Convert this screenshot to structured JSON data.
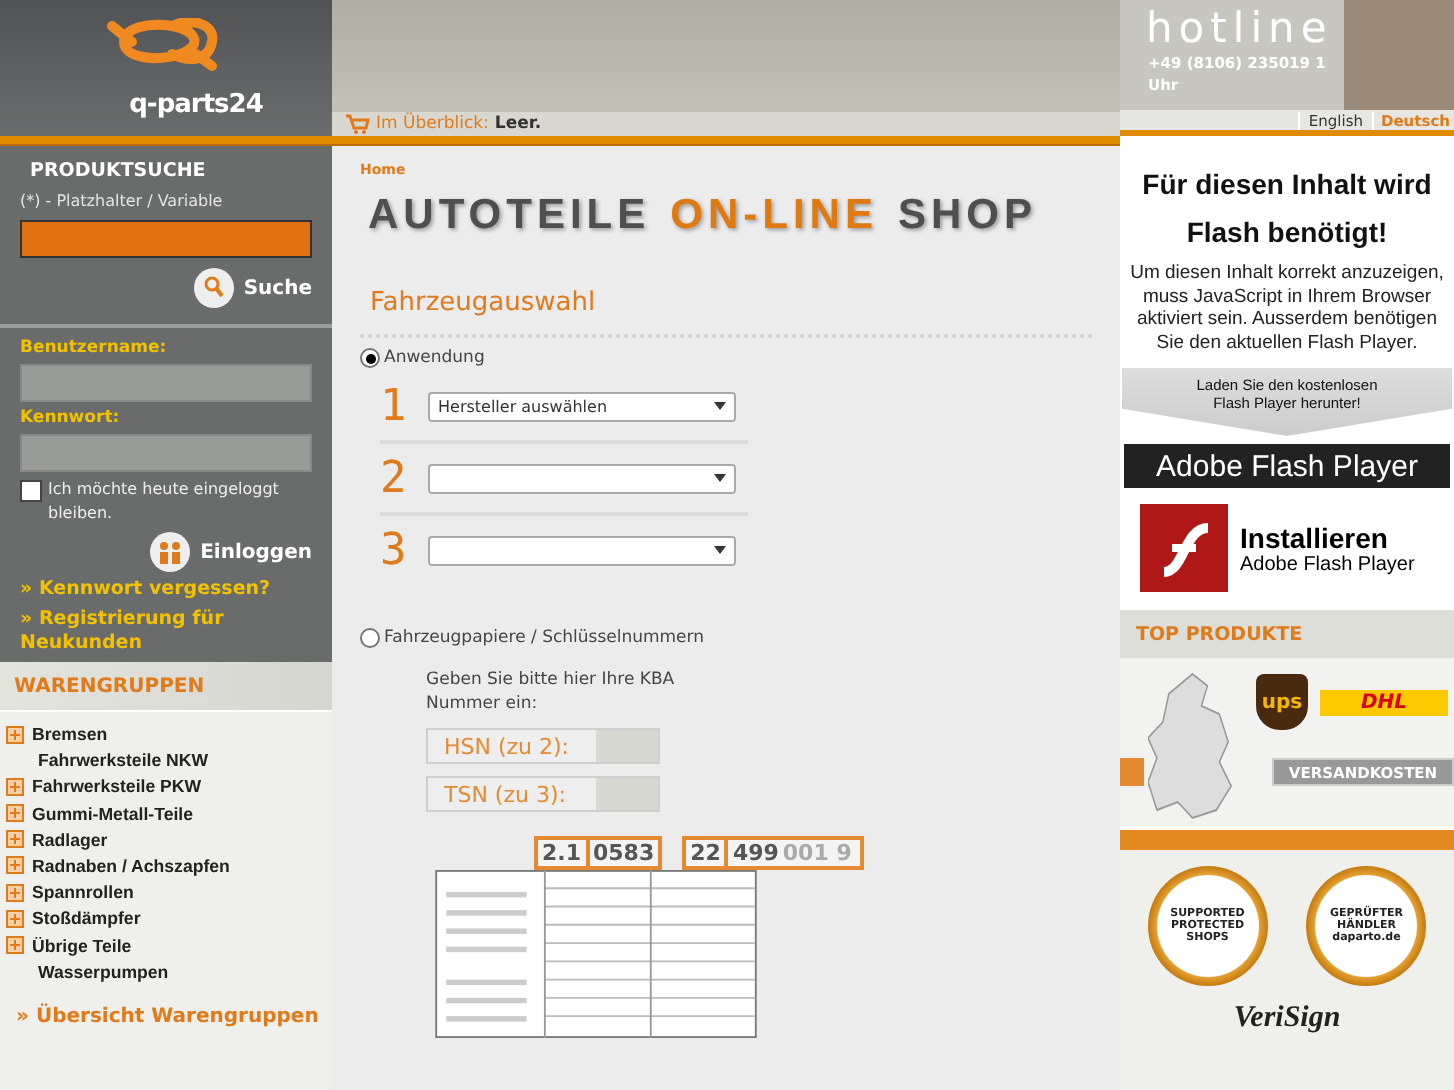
{
  "header": {
    "logo_text": "q-parts24",
    "cart_label": "Im Überblick:",
    "cart_value": "Leer.",
    "hotline": "hotline",
    "hotline_phone": "+49 (8106) 235019 1",
    "hotline_hours": "Uhr",
    "languages": [
      {
        "label": "English",
        "selected": false
      },
      {
        "label": "Deutsch",
        "selected": true
      }
    ]
  },
  "sidebar": {
    "search_title": "PRODUKTSUCHE",
    "search_hint": "(*) - Platzhalter / Variable",
    "search_button": "Suche",
    "username_label": "Benutzername:",
    "password_label": "Kennwort:",
    "remember": {
      "label": "Ich möchte heute eingeloggt bleiben.",
      "checked": false
    },
    "login_button": "Einloggen",
    "link_mark": "»",
    "links": [
      "Kennwort vergessen?",
      "Registrierung für Neukunden"
    ],
    "groups_title": "WARENGRUPPEN",
    "groups": [
      {
        "label": "Bremsen",
        "kind": "group"
      },
      {
        "label": "Fahrwerksteile NKW",
        "kind": "leaf"
      },
      {
        "label": "Fahrwerksteile PKW",
        "kind": "group"
      },
      {
        "label": "Gummi-Metall-Teile",
        "kind": "group"
      },
      {
        "label": "Radlager",
        "kind": "group"
      },
      {
        "label": "Radnaben / Achszapfen",
        "kind": "group"
      },
      {
        "label": "Spannrollen",
        "kind": "group"
      },
      {
        "label": "Stoßdämpfer",
        "kind": "group"
      },
      {
        "label": "Übrige Teile",
        "kind": "group"
      },
      {
        "label": "Wasserpumpen",
        "kind": "leaf"
      }
    ],
    "overview_mark": "»",
    "overview_link": "Übersicht Warengruppen"
  },
  "main": {
    "breadcrumb": "Home",
    "title": [
      "AUTOTEILE",
      "ON-LINE",
      "SHOP"
    ],
    "section_title": "Fahrzeugauswahl",
    "options": [
      {
        "label": "Anwendung",
        "selected": true
      },
      {
        "label": "Fahrzeugpapiere / Schlüsselnummern",
        "selected": false
      }
    ],
    "steps": [
      {
        "number": "1",
        "value": "Hersteller auswählen"
      },
      {
        "number": "2"
      },
      {
        "number": "3"
      }
    ],
    "kba_text": "Geben Sie bitte hier Ihre KBA Nummer ein:",
    "kba_fields": [
      "HSN (zu 2):",
      "TSN (zu 3):"
    ],
    "doc_numbers": {
      "hsn_code": "2.1",
      "hsn": "0583",
      "tsn_code": "22",
      "tsn": "499",
      "tsn_rest": "001 9"
    }
  },
  "right": {
    "flash_title": "Für diesen Inhalt wird Flash benötigt!",
    "flash_text": "Um diesen Inhalt korrekt anzuzeigen, muss JavaScript in Ihrem Browser aktiviert sein. Ausserdem benötigen Sie den aktuellen Flash Player.",
    "download_text": "Laden Sie den kostenlosen Flash Player herunter!",
    "player_bar": "Adobe Flash Player",
    "install_title": "Installieren",
    "install_sub": "Adobe Flash Player",
    "top_title": "TOP PRODUKTE",
    "ups": "ups",
    "dhl": "DHL",
    "shipping": "VERSANDKOSTEN",
    "seal_1": "SUPPORTED PROTECTED SHOPS",
    "seal_2": "GEPRÜFTER HÄNDLER daparto.de",
    "verisign": "VeriSign"
  }
}
